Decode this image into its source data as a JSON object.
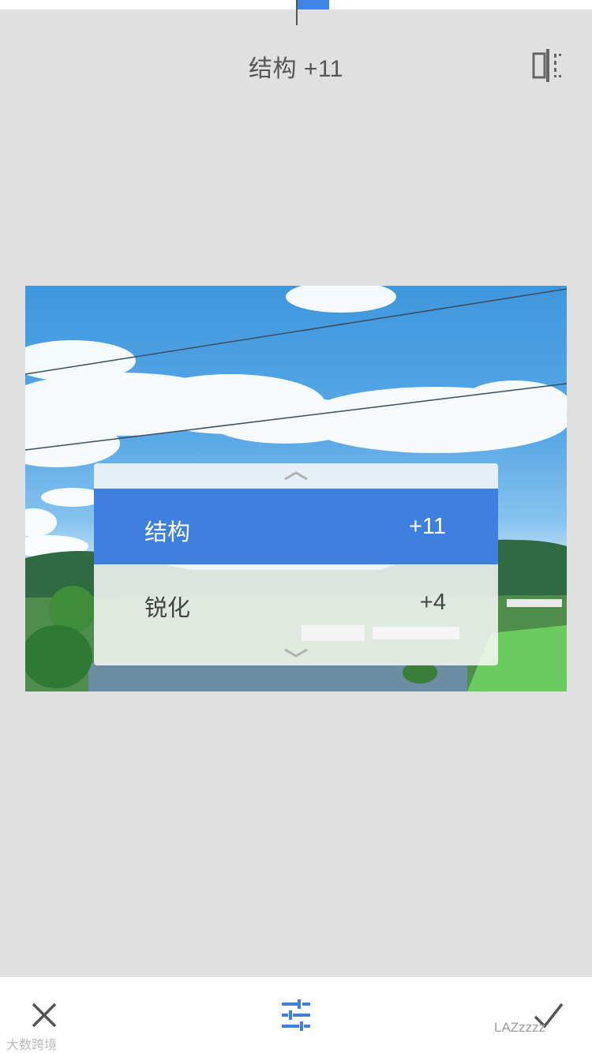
{
  "header": {
    "title": "结构 +11"
  },
  "top_slider": {
    "value": 11
  },
  "picker": {
    "items": [
      {
        "label": "结构",
        "value": "+11",
        "selected": true
      },
      {
        "label": "锐化",
        "value": "+4",
        "selected": false
      }
    ]
  },
  "toolbar": {
    "cancel_icon": "close-icon",
    "adjust_icon": "sliders-icon",
    "apply_icon": "check-icon"
  },
  "watermarks": {
    "left": "大数跨境",
    "right": "LAZzzzz"
  },
  "colors": {
    "accent": "#3f7fe0",
    "background": "#e0e0e0",
    "toolbar": "#ffffff"
  }
}
